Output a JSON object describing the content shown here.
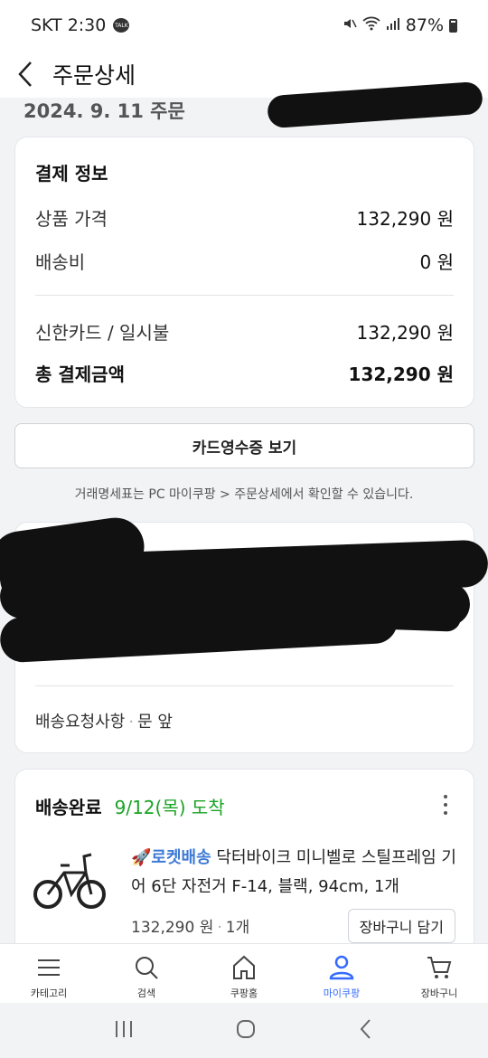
{
  "status_bar": {
    "carrier_time": "SKT 2:30",
    "talk_badge": "TALK",
    "battery": "87%"
  },
  "header": {
    "title": "주문상세"
  },
  "order": {
    "date_label": "2024. 9. 11 주문"
  },
  "payment": {
    "title": "결제 정보",
    "rows": [
      {
        "label": "상품 가격",
        "value": "132,290 원"
      },
      {
        "label": "배송비",
        "value": "0 원"
      },
      {
        "label": "신한카드 / 일시불",
        "value": "132,290 원"
      }
    ],
    "total_label": "총 결제금액",
    "total_value": "132,290 원"
  },
  "receipt_button": "카드영수증 보기",
  "notice": "거래명세표는 PC 마이쿠팡 > 주문상세에서 확인할 수 있습니다.",
  "address": {
    "request_label": "배송요청사항",
    "request_value": "문 앞"
  },
  "delivery": {
    "status": "배송완료",
    "arrival": "9/12(목) 도착",
    "rocket_label": "로켓배송",
    "product_name": " 닥터바이크 미니벨로 스틸프레임 기어 6단 자전거 F-14, 블랙, 94cm, 1개",
    "price": "132,290 원",
    "quantity": "1개",
    "cart_button": "장바구니 담기"
  },
  "bottom_nav": {
    "items": [
      {
        "label": "카테고리",
        "icon": "menu-icon"
      },
      {
        "label": "검색",
        "icon": "search-icon"
      },
      {
        "label": "쿠팡홈",
        "icon": "home-icon"
      },
      {
        "label": "마이쿠팡",
        "icon": "person-icon"
      },
      {
        "label": "장바구니",
        "icon": "cart-icon"
      }
    ],
    "active_color": "#346aff"
  },
  "colors": {
    "delivered_date": "#19a324",
    "rocket": "#3d7ad6"
  }
}
